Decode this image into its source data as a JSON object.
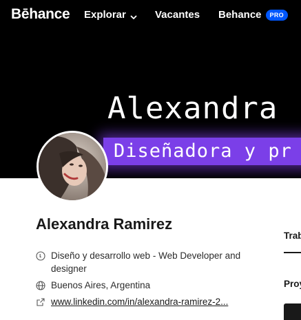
{
  "nav": {
    "logo": "Bēhance",
    "explore": "Explorar",
    "jobs": "Vacantes",
    "behance": "Behance",
    "pro_badge": "PRO"
  },
  "banner": {
    "title": "Alexandra",
    "subtitle": "Diseñadora y pr"
  },
  "profile": {
    "name": "Alexandra Ramirez",
    "occupation": "Diseño y desarrollo web - Web Developer and designer",
    "location": "Buenos Aires, Argentina",
    "link": "www.linkedin.com/in/alexandra-ramirez-2..."
  },
  "right": {
    "tab_partial": "Trab",
    "section_partial": "Proy"
  },
  "colors": {
    "pro_badge": "#0057ff",
    "banner_highlight": "#7b3fe8",
    "nav_bg": "#000000"
  },
  "icons": {
    "explore_chevron": "chevron-down-icon",
    "occupation": "info-circle-icon",
    "location": "globe-icon",
    "link": "external-link-icon"
  }
}
